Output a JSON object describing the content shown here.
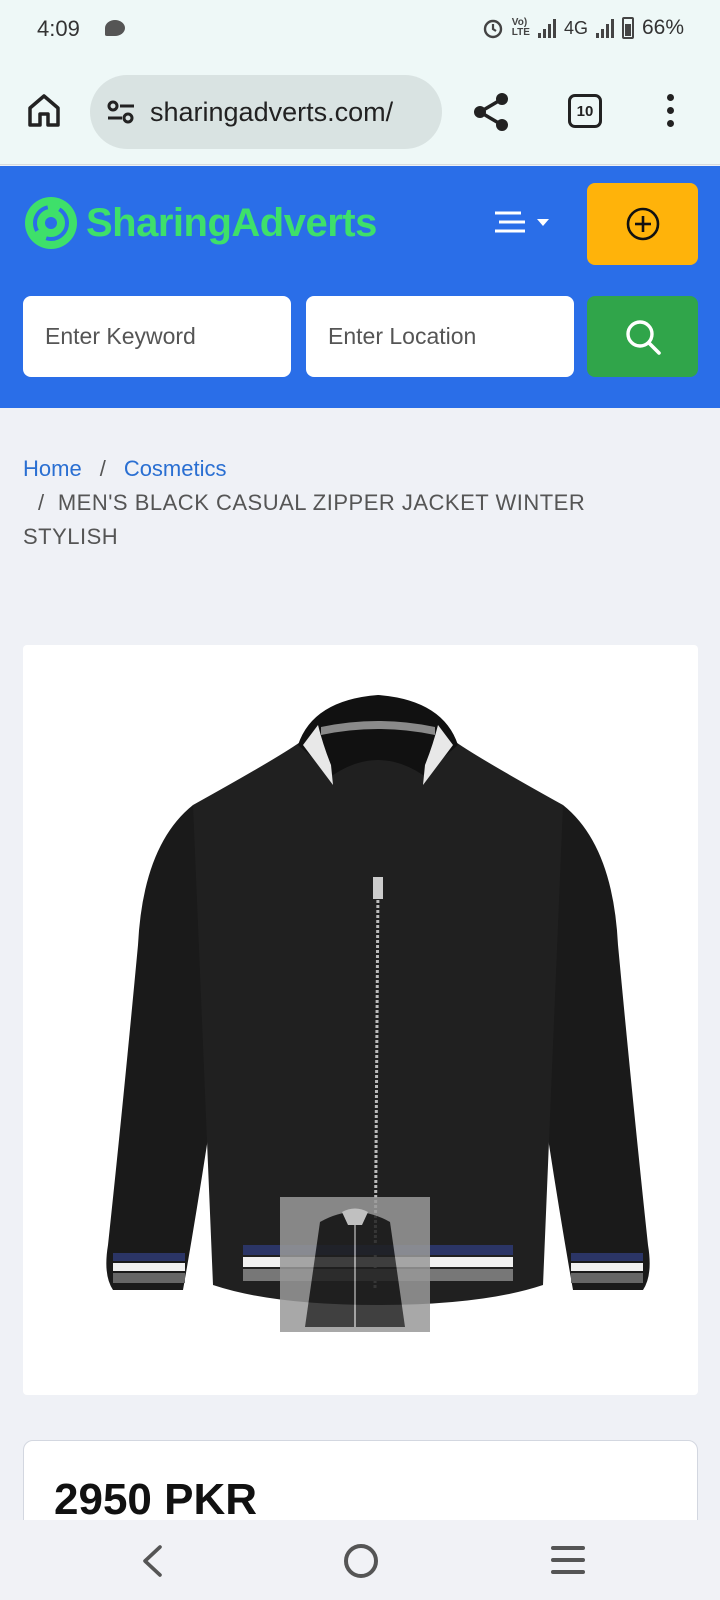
{
  "status_bar": {
    "time": "4:09",
    "network": "4G",
    "battery": "66%"
  },
  "browser": {
    "url": "sharingadverts.com/",
    "tab_count": "10"
  },
  "site": {
    "logo_text": "SharingAdverts",
    "brand_color": "#2a6ee8",
    "accent_color": "#ffb30a",
    "search_color": "#30a54a",
    "keyword_placeholder": "Enter Keyword",
    "location_placeholder": "Enter Location"
  },
  "breadcrumb": {
    "home": "Home",
    "category": "Cosmetics",
    "current": "MEN'S BLACK CASUAL ZIPPER JACKET WINTER STYLISH"
  },
  "product": {
    "price": "2950 PKR"
  },
  "icons": [
    "home-icon",
    "tune-icon",
    "share-icon",
    "more-icon",
    "hamburger-icon",
    "add-icon",
    "search-icon",
    "back-icon",
    "nav-home-icon",
    "recents-icon"
  ]
}
